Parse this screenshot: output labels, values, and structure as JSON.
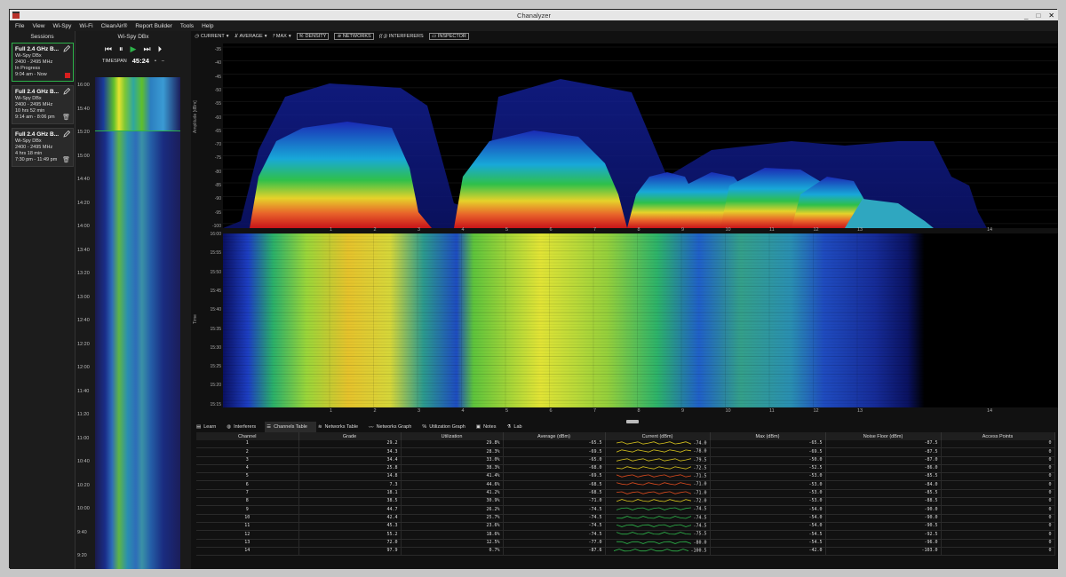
{
  "window": {
    "title": "Chanalyzer",
    "controls": [
      "_",
      "□",
      "✕"
    ]
  },
  "menu": [
    "File",
    "View",
    "Wi-Spy",
    "Wi-Fi",
    "CleanAir®",
    "Report Builder",
    "Tools",
    "Help"
  ],
  "sessions": {
    "title": "Sessions",
    "items": [
      {
        "name": "Full 2.4 GHz B...",
        "device": "Wi-Spy DBx",
        "range": "2400 - 2495 MHz",
        "line3": "In Progress",
        "line4": "9:04 am - Now",
        "active": true
      },
      {
        "name": "Full 2.4 GHz B...",
        "device": "Wi-Spy DBx",
        "range": "2400 - 2495 MHz",
        "line3": "10 hrs 52 min",
        "line4": "9:14 am - 8:06 pm",
        "active": false
      },
      {
        "name": "Full 2.4 GHz B...",
        "device": "Wi-Spy DBx",
        "range": "2400 - 2495 MHz",
        "line3": "4 hrs 18 min",
        "line4": "7:30 pm - 11:49 pm",
        "active": false
      }
    ]
  },
  "player": {
    "device": "Wi-Spy DBx",
    "timespan_label": "TIMESPAN",
    "timespan_value": "45:24"
  },
  "mini_times": [
    "16:00",
    "15:40",
    "15:20",
    "15:00",
    "14:40",
    "14:20",
    "14:00",
    "13:40",
    "13:20",
    "13:00",
    "12:40",
    "12:20",
    "12:00",
    "11:40",
    "11:20",
    "11:00",
    "10:40",
    "10:20",
    "10:00",
    "9:40",
    "9:20"
  ],
  "toolbar": {
    "current": "CURRENT",
    "average": "AVERAGE",
    "max": "MAX",
    "density": "DENSITY",
    "networks": "NETWORKS",
    "interferers": "INTERFERERS",
    "inspector": "INSPECTOR"
  },
  "spectrum": {
    "ylabel": "Amplitude [dBm]",
    "yticks": [
      "-35",
      "-40",
      "-45",
      "-50",
      "-55",
      "-60",
      "-65",
      "-70",
      "-75",
      "-80",
      "-85",
      "-90",
      "-95",
      "-100"
    ],
    "channels": [
      "1",
      "2",
      "3",
      "4",
      "5",
      "6",
      "7",
      "8",
      "9",
      "10",
      "11",
      "12",
      "13",
      "14"
    ]
  },
  "waterfall": {
    "ylabel": "Time",
    "yticks": [
      "16:00",
      "15:55",
      "15:50",
      "15:45",
      "15:40",
      "15:35",
      "15:30",
      "15:25",
      "15:20",
      "15:15"
    ]
  },
  "tabs": [
    "Learn",
    "Interferers",
    "Channels Table",
    "Networks Table",
    "Networks Graph",
    "Utilization Graph",
    "Notes",
    "Lab"
  ],
  "table": {
    "headers": [
      "Channel",
      "Grade",
      "Utilization",
      "Average (dBm)",
      "Current (dBm)",
      "Max (dBm)",
      "Noise Floor (dBm)",
      "Access Points"
    ],
    "rows": [
      {
        "ch": "1",
        "grade": "29.2",
        "util": "29.8%",
        "avg": "-65.5",
        "cur": "-74.0",
        "max": "-65.5",
        "nf": "-87.5",
        "ap": "0"
      },
      {
        "ch": "2",
        "grade": "34.3",
        "util": "28.3%",
        "avg": "-69.5",
        "cur": "-78.0",
        "max": "-69.5",
        "nf": "-87.5",
        "ap": "0"
      },
      {
        "ch": "3",
        "grade": "34.4",
        "util": "33.0%",
        "avg": "-65.0",
        "cur": "-79.5",
        "max": "-50.0",
        "nf": "-87.0",
        "ap": "0"
      },
      {
        "ch": "4",
        "grade": "25.8",
        "util": "38.3%",
        "avg": "-68.0",
        "cur": "-72.5",
        "max": "-52.5",
        "nf": "-86.0",
        "ap": "0"
      },
      {
        "ch": "5",
        "grade": "14.8",
        "util": "41.4%",
        "avg": "-69.5",
        "cur": "-71.5",
        "max": "-53.0",
        "nf": "-85.5",
        "ap": "0"
      },
      {
        "ch": "6",
        "grade": "7.3",
        "util": "44.6%",
        "avg": "-68.5",
        "cur": "-71.0",
        "max": "-53.0",
        "nf": "-84.0",
        "ap": "0"
      },
      {
        "ch": "7",
        "grade": "18.1",
        "util": "41.2%",
        "avg": "-68.5",
        "cur": "-71.0",
        "max": "-53.0",
        "nf": "-85.5",
        "ap": "0"
      },
      {
        "ch": "8",
        "grade": "38.5",
        "util": "30.9%",
        "avg": "-71.0",
        "cur": "-72.0",
        "max": "-53.0",
        "nf": "-88.5",
        "ap": "0"
      },
      {
        "ch": "9",
        "grade": "44.7",
        "util": "26.2%",
        "avg": "-74.5",
        "cur": "-74.5",
        "max": "-54.0",
        "nf": "-90.0",
        "ap": "0"
      },
      {
        "ch": "10",
        "grade": "42.4",
        "util": "25.7%",
        "avg": "-74.5",
        "cur": "-74.5",
        "max": "-54.0",
        "nf": "-90.0",
        "ap": "0"
      },
      {
        "ch": "11",
        "grade": "45.3",
        "util": "23.6%",
        "avg": "-74.5",
        "cur": "-74.5",
        "max": "-54.0",
        "nf": "-90.5",
        "ap": "0"
      },
      {
        "ch": "12",
        "grade": "55.2",
        "util": "18.6%",
        "avg": "-74.5",
        "cur": "-75.5",
        "max": "-54.5",
        "nf": "-92.5",
        "ap": "0"
      },
      {
        "ch": "13",
        "grade": "72.0",
        "util": "12.5%",
        "avg": "-77.0",
        "cur": "-80.0",
        "max": "-54.5",
        "nf": "-96.0",
        "ap": "0"
      },
      {
        "ch": "14",
        "grade": "97.9",
        "util": "0.7%",
        "avg": "-87.6",
        "cur": "-100.5",
        "max": "-42.0",
        "nf": "-103.0",
        "ap": "0"
      }
    ]
  },
  "colors": {
    "accent": "#2db34a",
    "stop": "#d81e1e",
    "spark_hot": "#d94a1e",
    "spark_warm": "#d6c21e",
    "spark_cool": "#2db34a"
  }
}
